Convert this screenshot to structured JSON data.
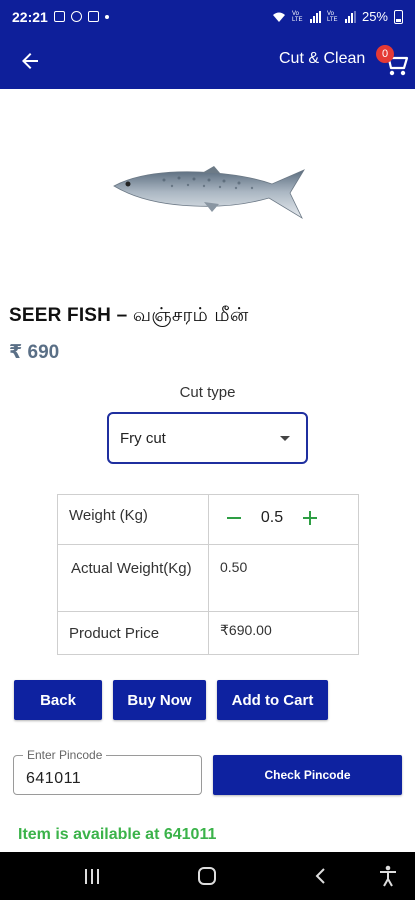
{
  "status_bar": {
    "time": "22:21",
    "battery": "25%",
    "network_labels": [
      "Vo LTE",
      "Vo LTE"
    ]
  },
  "app_bar": {
    "title": "Cut & Clean",
    "cart_count": "0"
  },
  "product": {
    "name": "SEER FISH –",
    "name_tamil": "வஞ்சரம் மீன்",
    "price": "₹ 690"
  },
  "cut_type": {
    "label": "Cut type",
    "selected": "Fry cut"
  },
  "details": {
    "weight_label": "Weight (Kg)",
    "weight_value": "0.5",
    "actual_weight_label": "Actual Weight(Kg)",
    "actual_weight_value": "0.50",
    "price_label": "Product Price",
    "price_value": "₹690.00"
  },
  "actions": {
    "back": "Back",
    "buy_now": "Buy Now",
    "add_to_cart": "Add to Cart"
  },
  "pincode": {
    "legend": "Enter Pincode",
    "value": "641011",
    "check_button": "Check Pincode"
  },
  "availability": {
    "message": "Item is available at 641011"
  },
  "colors": {
    "primary": "#0e1f9a",
    "button": "#0e22a0",
    "available_green": "#3bb34a",
    "price_gray": "#5a6f86",
    "stepper_green": "#2e9e44",
    "badge_red": "#e53935"
  }
}
